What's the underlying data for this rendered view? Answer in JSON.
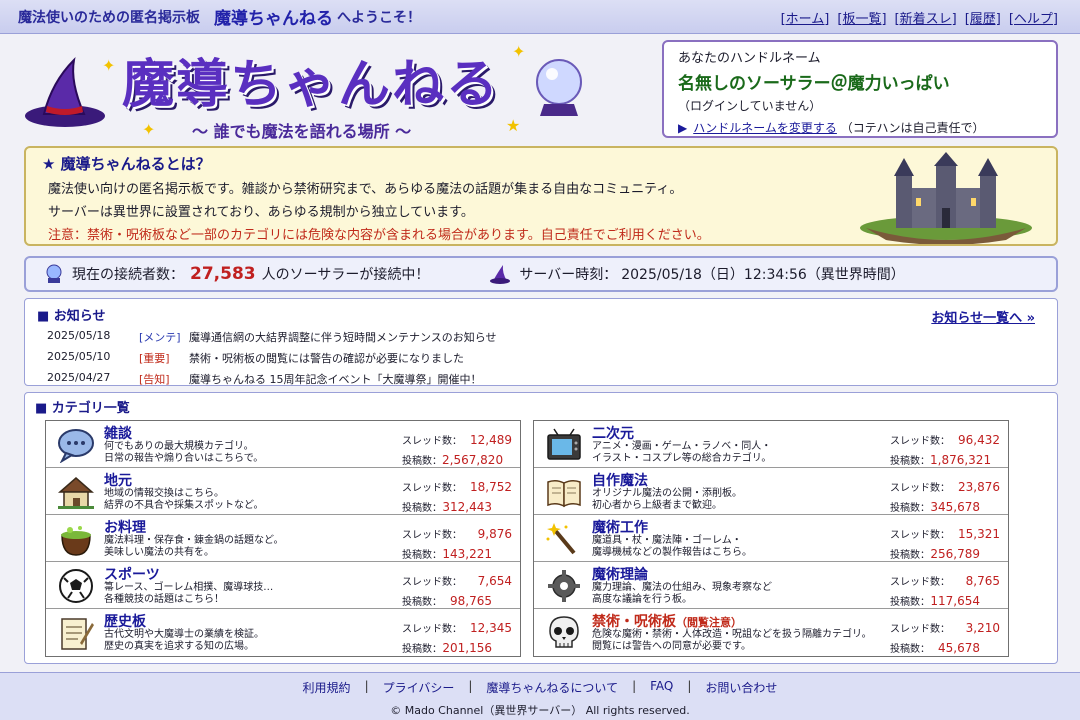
{
  "topbar": {
    "subtitle": "魔法使いのための匿名掲示板",
    "site_name": "魔導ちゃんねる",
    "welcome": "へようこそ！",
    "nav": [
      "[ホーム]",
      "[板一覧]",
      "[新着スレ]",
      "[履歴]",
      "[ヘルプ]"
    ]
  },
  "logo": {
    "title": "魔導ちゃんねる",
    "tagline": "〜 誰でも魔法を語れる場所 〜"
  },
  "handle": {
    "label": "あなたのハンドルネーム",
    "name": "名無しのソーサラー＠魔力いっぱい",
    "status": "（ログインしていません）",
    "change_link": "ハンドルネームを変更する",
    "change_note": "（コテハンは自己責任で）"
  },
  "about": {
    "title": "★ 魔導ちゃんねるとは？",
    "line1": "魔法使い向けの匿名掲示板です。雑談から禁術研究まで、あらゆる魔法の話題が集まる自由なコミュニティ。",
    "line2": "サーバーは異世界に設置されており、あらゆる規制から独立しています。",
    "warning": "注意：禁術・呪術板など一部のカテゴリには危険な内容が含まれる場合があります。自己責任でご利用ください。"
  },
  "stats": {
    "online_label": "現在の接続者数：",
    "online_count": "27,583",
    "online_suffix": "人のソーサラーが接続中！",
    "time_label": "サーバー時刻：",
    "time_value": "2025/05/18（日）12:34:56（異世界時間）"
  },
  "news": {
    "title": "■ お知らせ",
    "all_link": "お知らせ一覧へ »",
    "items": [
      {
        "date": "2025/05/18",
        "tag": "[メンテ]",
        "text": "魔導通信網の大結界調整に伴う短時間メンテナンスのお知らせ"
      },
      {
        "date": "2025/05/10",
        "tag": "[重要]",
        "text": "禁術・呪術板の閲覧には警告の確認が必要になりました"
      },
      {
        "date": "2025/04/27",
        "tag": "[告知]",
        "text": "魔導ちゃんねる 15周年記念イベント「大魔導祭」開催中！"
      }
    ]
  },
  "categories": {
    "title": "■ カテゴリ一覧",
    "threads_label": "スレッド数：",
    "posts_label": "投稿数：",
    "left": [
      {
        "name": "雑談",
        "desc1": "何でもありの最大規模カテゴリ。",
        "desc2": "日常の報告や煽り合いはこちらで。",
        "threads": "12,489",
        "posts": "2,567,820",
        "icon": "chat-bubble-icon"
      },
      {
        "name": "地元",
        "desc1": "地域の情報交換はこちら。",
        "desc2": "結界の不具合や採集スポットなど。",
        "threads": "18,752",
        "posts": "312,443",
        "icon": "house-icon"
      },
      {
        "name": "お料理",
        "desc1": "魔法料理・保存食・錬金鍋の話題など。",
        "desc2": "美味しい魔法の共有を。",
        "threads": "9,876",
        "posts": "143,221",
        "icon": "cauldron-icon"
      },
      {
        "name": "スポーツ",
        "desc1": "箒レース、ゴーレム相撲、魔導球技…",
        "desc2": "各種競技の話題はこちら！",
        "threads": "7,654",
        "posts": "98,765",
        "icon": "soccer-ball-icon"
      },
      {
        "name": "歴史板",
        "desc1": "古代文明や大魔導士の業績を検証。",
        "desc2": "歴史の真実を追求する知の広場。",
        "threads": "12,345",
        "posts": "201,156",
        "icon": "notepad-icon"
      }
    ],
    "right": [
      {
        "name": "二次元",
        "warn": "",
        "desc1": "アニメ・漫画・ゲーム・ラノベ・同人・",
        "desc2": "イラスト・コスプレ等の総合カテゴリ。",
        "threads": "96,432",
        "posts": "1,876,321",
        "icon": "tv-icon"
      },
      {
        "name": "自作魔法",
        "warn": "",
        "desc1": "オリジナル魔法の公開・添削板。",
        "desc2": "初心者から上級者まで歓迎。",
        "threads": "23,876",
        "posts": "345,678",
        "icon": "book-icon"
      },
      {
        "name": "魔術工作",
        "warn": "",
        "desc1": "魔道具・杖・魔法陣・ゴーレム・",
        "desc2": "魔導機械などの製作報告はこちら。",
        "threads": "15,321",
        "posts": "256,789",
        "icon": "magic-wand-icon"
      },
      {
        "name": "魔術理論",
        "warn": "",
        "desc1": "魔力理論、魔法の仕組み、現象考察など",
        "desc2": "高度な議論を行う板。",
        "threads": "8,765",
        "posts": "117,654",
        "icon": "gear-icon"
      },
      {
        "name": "禁術・呪術板",
        "warn": "（閲覧注意）",
        "desc1": "危険な魔術・禁術・人体改造・呪詛などを扱う隔離カテゴリ。",
        "desc2": "閲覧には警告への同意が必要です。",
        "threads": "3,210",
        "posts": "45,678",
        "icon": "skull-icon"
      }
    ]
  },
  "footer": {
    "links": [
      "利用規約",
      "プライバシー",
      "魔導ちゃんねるについて",
      "FAQ",
      "お問い合わせ"
    ],
    "copyright": "© Mado Channel（異世界サーバー） All rights reserved."
  },
  "colors": {
    "accent": "#1a1a9a",
    "logo": "#5a2fc0",
    "warning": "#c02a1a",
    "count": "#c02020"
  }
}
